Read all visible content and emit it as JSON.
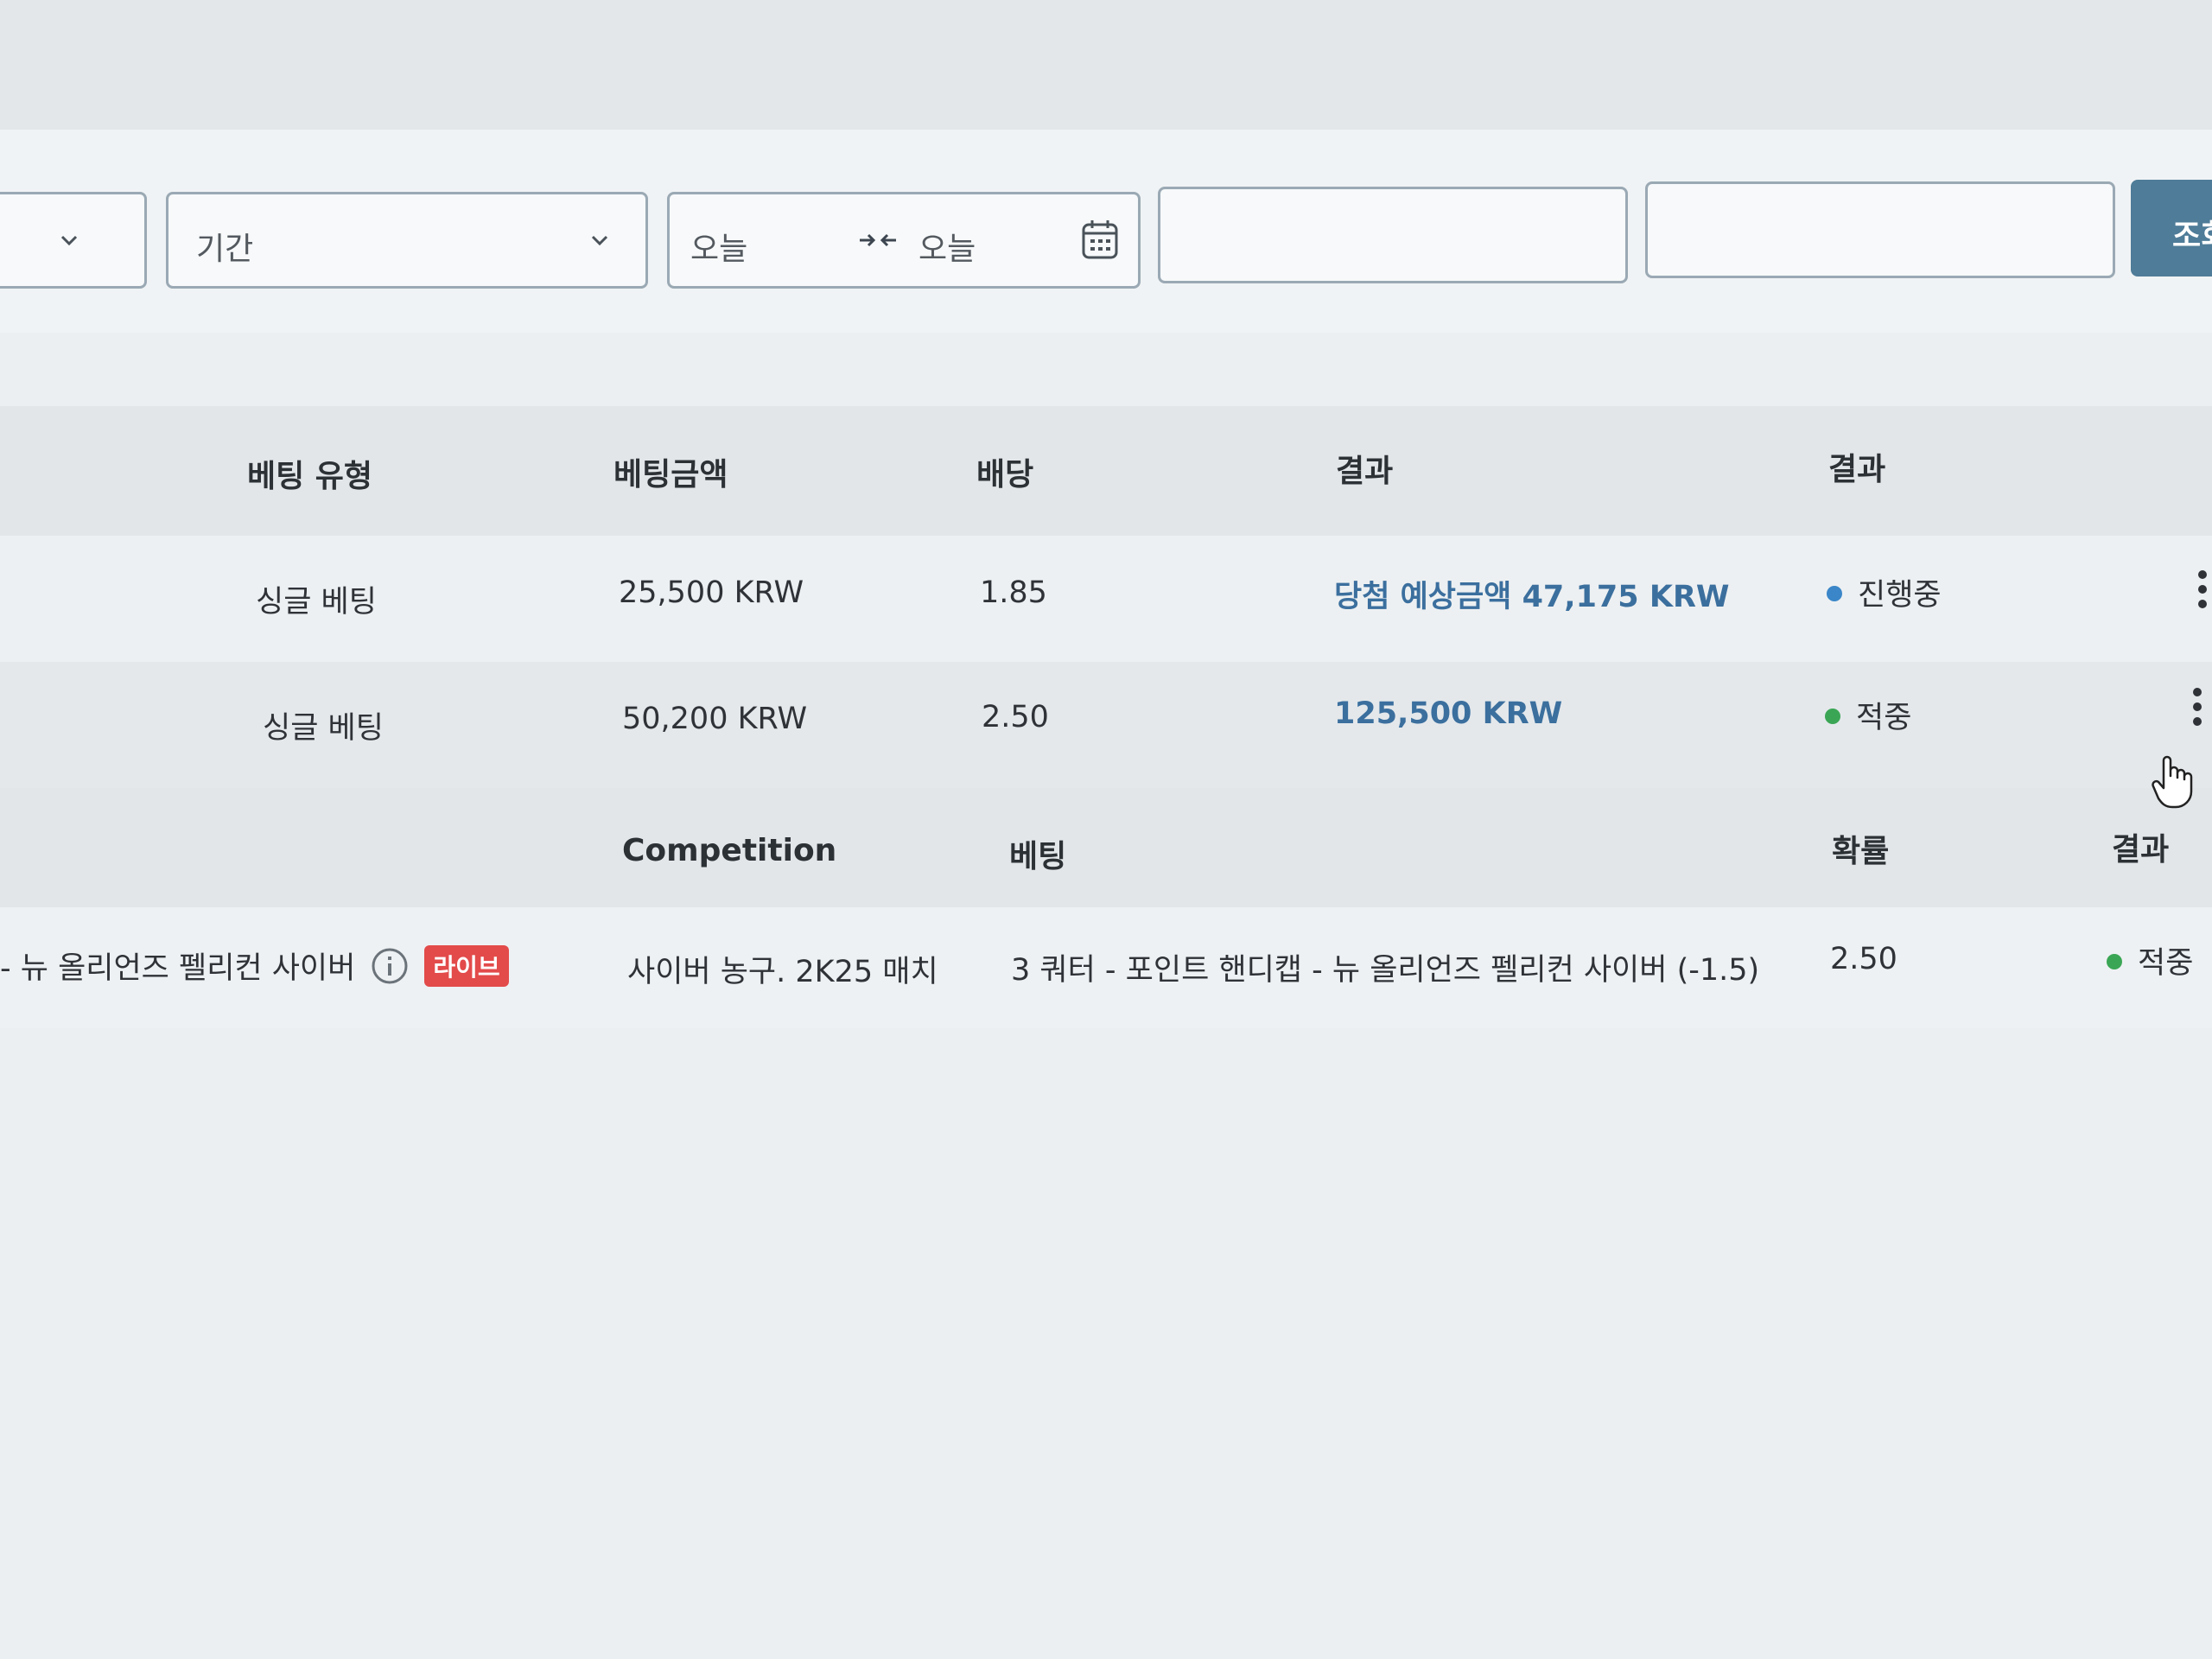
{
  "filters": {
    "first_select_value": "",
    "period_select": "기간",
    "date_range": {
      "start": "오늘",
      "end": "오늘"
    },
    "input1_placeholder": "",
    "input2_placeholder": "",
    "search_button": "조회"
  },
  "bets_table": {
    "headers": [
      "베팅 유형",
      "베팅금액",
      "배당",
      "결과",
      "결과"
    ],
    "rows": [
      {
        "type": "싱글 베팅",
        "amount": "25,500 KRW",
        "odds": "1.85",
        "result": "당첨 예상금액 47,175 KRW",
        "status": "진행중",
        "status_color": "#3a86c8"
      },
      {
        "type": "싱글 베팅",
        "amount": "50,200 KRW",
        "odds": "2.50",
        "result": "125,500 KRW",
        "status": "적중",
        "status_color": "#3aa655"
      }
    ]
  },
  "detail_table": {
    "headers": [
      "Competition",
      "베팅",
      "확률",
      "결과"
    ],
    "row": {
      "match": "- 뉴 올리언즈 펠리컨 사이버",
      "live_badge": "라이브",
      "competition": "사이버 농구. 2K25 매치",
      "bet": "3 쿼터 - 포인트 핸디캡 - 뉴 올리언즈 펠리컨 사이버 (-1.5)",
      "probability": "2.50",
      "result": "적중",
      "result_color": "#3aa655"
    }
  },
  "colors": {
    "accent": "#4f7c98",
    "link": "#3b6f9e",
    "live": "#e34a4a"
  }
}
